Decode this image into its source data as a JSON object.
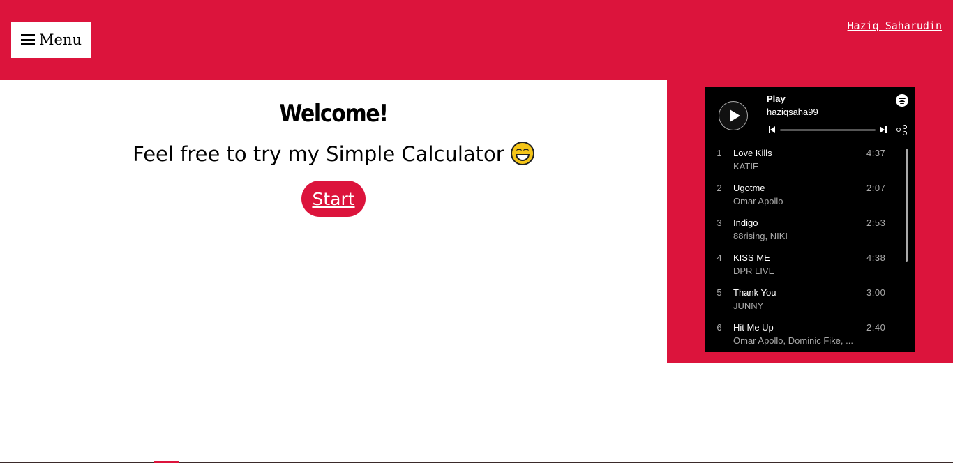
{
  "header": {
    "menu_label": "Menu",
    "author": "Haziq Saharudin"
  },
  "main": {
    "welcome": "Welcome!",
    "subtitle": "Feel free to try my Simple Calculator",
    "emoji": "grinning-face",
    "start_label": "Start"
  },
  "player": {
    "title": "Play",
    "user": "haziqsaha99",
    "tracks": [
      {
        "num": "1",
        "name": "Love Kills",
        "artist": "KATIE",
        "duration": "4:37"
      },
      {
        "num": "2",
        "name": "Ugotme",
        "artist": "Omar Apollo",
        "duration": "2:07"
      },
      {
        "num": "3",
        "name": "Indigo",
        "artist": "88rising, NIKI",
        "duration": "2:53"
      },
      {
        "num": "4",
        "name": "KISS ME",
        "artist": "DPR LIVE",
        "duration": "4:38"
      },
      {
        "num": "5",
        "name": "Thank You",
        "artist": "JUNNY",
        "duration": "3:00"
      },
      {
        "num": "6",
        "name": "Hit Me Up",
        "artist": "Omar Apollo, Dominic Fike, ...",
        "duration": "2:40"
      }
    ]
  },
  "colors": {
    "accent": "#dc143c",
    "player_bg": "#000000"
  },
  "icons": [
    "menu-icon",
    "play-icon",
    "spotify-icon",
    "previous-icon",
    "next-icon",
    "share-icon"
  ]
}
